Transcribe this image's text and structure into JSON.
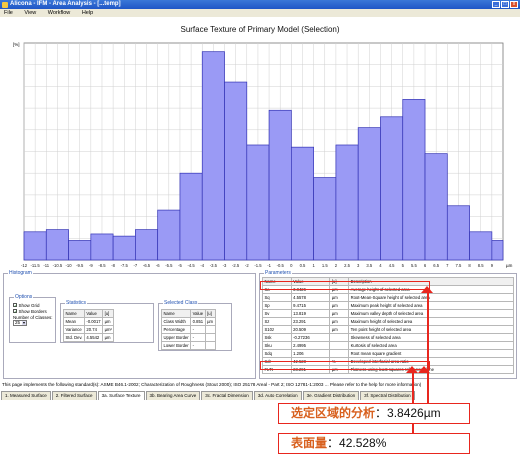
{
  "window": {
    "title": "Alicona - IFM - Area Analysis - [...temp]",
    "buttons": [
      "_",
      "□",
      "x"
    ]
  },
  "menu": [
    "File",
    "View",
    "Workflow",
    "Help"
  ],
  "chart_data": {
    "type": "bar",
    "title": "Surface Texture of Primary Model (Selection)",
    "ylabel": "[%]",
    "xlabel": "µm",
    "ylim": [
      0,
      10
    ],
    "yticks": [],
    "x_tick_labels": [
      "-12",
      "-11.5",
      "-11",
      "-10.5",
      "-10",
      "-9.5",
      "-9",
      "-8.5",
      "-8",
      "-7.5",
      "-7",
      "-6.5",
      "-6",
      "-5.5",
      "-5",
      "-4.5",
      "-4",
      "-3.5",
      "-3",
      "-2.5",
      "-2",
      "-1.5",
      "-1",
      "-0.5",
      "0",
      "0.5",
      "1",
      "1.5",
      "2",
      "2.5",
      "3",
      "3.5",
      "4",
      "4.5",
      "5",
      "5.5",
      "6",
      "6.5",
      "7",
      "7.5",
      "8",
      "8.5",
      "9"
    ],
    "x": [
      -12,
      -11,
      -10,
      -9,
      -8,
      -7,
      -6,
      -5,
      -4,
      -3,
      -2,
      -1,
      0,
      1,
      2,
      3,
      4,
      5,
      6,
      7,
      8,
      9
    ],
    "values": [
      1.3,
      1.4,
      0.9,
      1.2,
      1.1,
      1.4,
      2.3,
      4.0,
      9.6,
      8.2,
      5.3,
      6.9,
      5.2,
      3.8,
      5.3,
      6.1,
      6.6,
      7.4,
      4.9,
      2.5,
      1.3,
      0.9
    ],
    "color": "#9a9af5",
    "edge": "#3232b4",
    "grid": true
  },
  "histogram": {
    "title": "Histogram",
    "options": {
      "title": "Options",
      "show_grid": "Show Grid",
      "show_borders": "Show Borders",
      "classes_label": "Number of Classes:",
      "classes_value": "25"
    },
    "statistics": {
      "title": "Statistics",
      "headers": [
        "Name",
        "Value",
        "[u]"
      ],
      "rows": [
        [
          "Mean",
          "-0.0017",
          "µm"
        ],
        [
          "Variance",
          "20.74",
          "µm²"
        ],
        [
          "Std. Dev.",
          "4.5542",
          "µm"
        ]
      ]
    },
    "selected_class": {
      "title": "Selected Class",
      "headers": [
        "Name",
        "Value",
        "[u]"
      ],
      "rows": [
        [
          "Class Width",
          "0.851",
          "µm"
        ],
        [
          "Percentage",
          "-",
          ""
        ],
        [
          "Upper Border",
          "-",
          ""
        ],
        [
          "Lower Border",
          "-",
          ""
        ]
      ]
    }
  },
  "parameters": {
    "title": "Parameters",
    "headers": [
      "Name",
      "Value",
      "[u]",
      "Description"
    ],
    "rows": [
      [
        "Sa",
        "3.8426",
        "µm",
        "Average height of selected area"
      ],
      [
        "Sq",
        "4.5578",
        "µm",
        "Root-Mean-Square height of selected area"
      ],
      [
        "Sp",
        "9.4715",
        "µm",
        "Maximum peak height of selected area"
      ],
      [
        "Sv",
        "13.819",
        "µm",
        "Maximum valley depth of selected area"
      ],
      [
        "Sz",
        "23.291",
        "µm",
        "Maximum height of selected area"
      ],
      [
        "S10z",
        "20.509",
        "µm",
        "Ten point height of selected area"
      ],
      [
        "Ssk",
        "-0.27236",
        "",
        "Skewness of selected area"
      ],
      [
        "Sku",
        "2.4995",
        "",
        "Kurtosis of selected area"
      ],
      [
        "Sdq",
        "1.206",
        "",
        "Root mean square gradient"
      ],
      [
        "Sdr",
        "42.528",
        "%",
        "Developed interfacial area ratio"
      ],
      [
        "FLTt",
        "23.291",
        "µm",
        "Flatness using least squares reference plane"
      ]
    ]
  },
  "standards_text": "This page implements the following standard(s): ASME B46.1-2002; Characterization of Roughness (Stout 2000); ISO 25178 Areal - Part 2; ISO 12781-1:2003 ... Please refer to the help for more information)",
  "tabs": [
    "1. Measured Surface",
    "2. Filtered Surface",
    "3a. Surface Texture",
    "3b. Bearing Area Curve",
    "3c. Fractal Dimension",
    "3d. Auto Correlation",
    "3e. Gradient Distribution",
    "3f. Spectral Distribution"
  ],
  "annotations": {
    "callout_sa_label": "选定区域的分析",
    "callout_sa_value": "：3.8426µm",
    "callout_sdr_label": "表面量",
    "callout_sdr_value": "：42.528%"
  }
}
